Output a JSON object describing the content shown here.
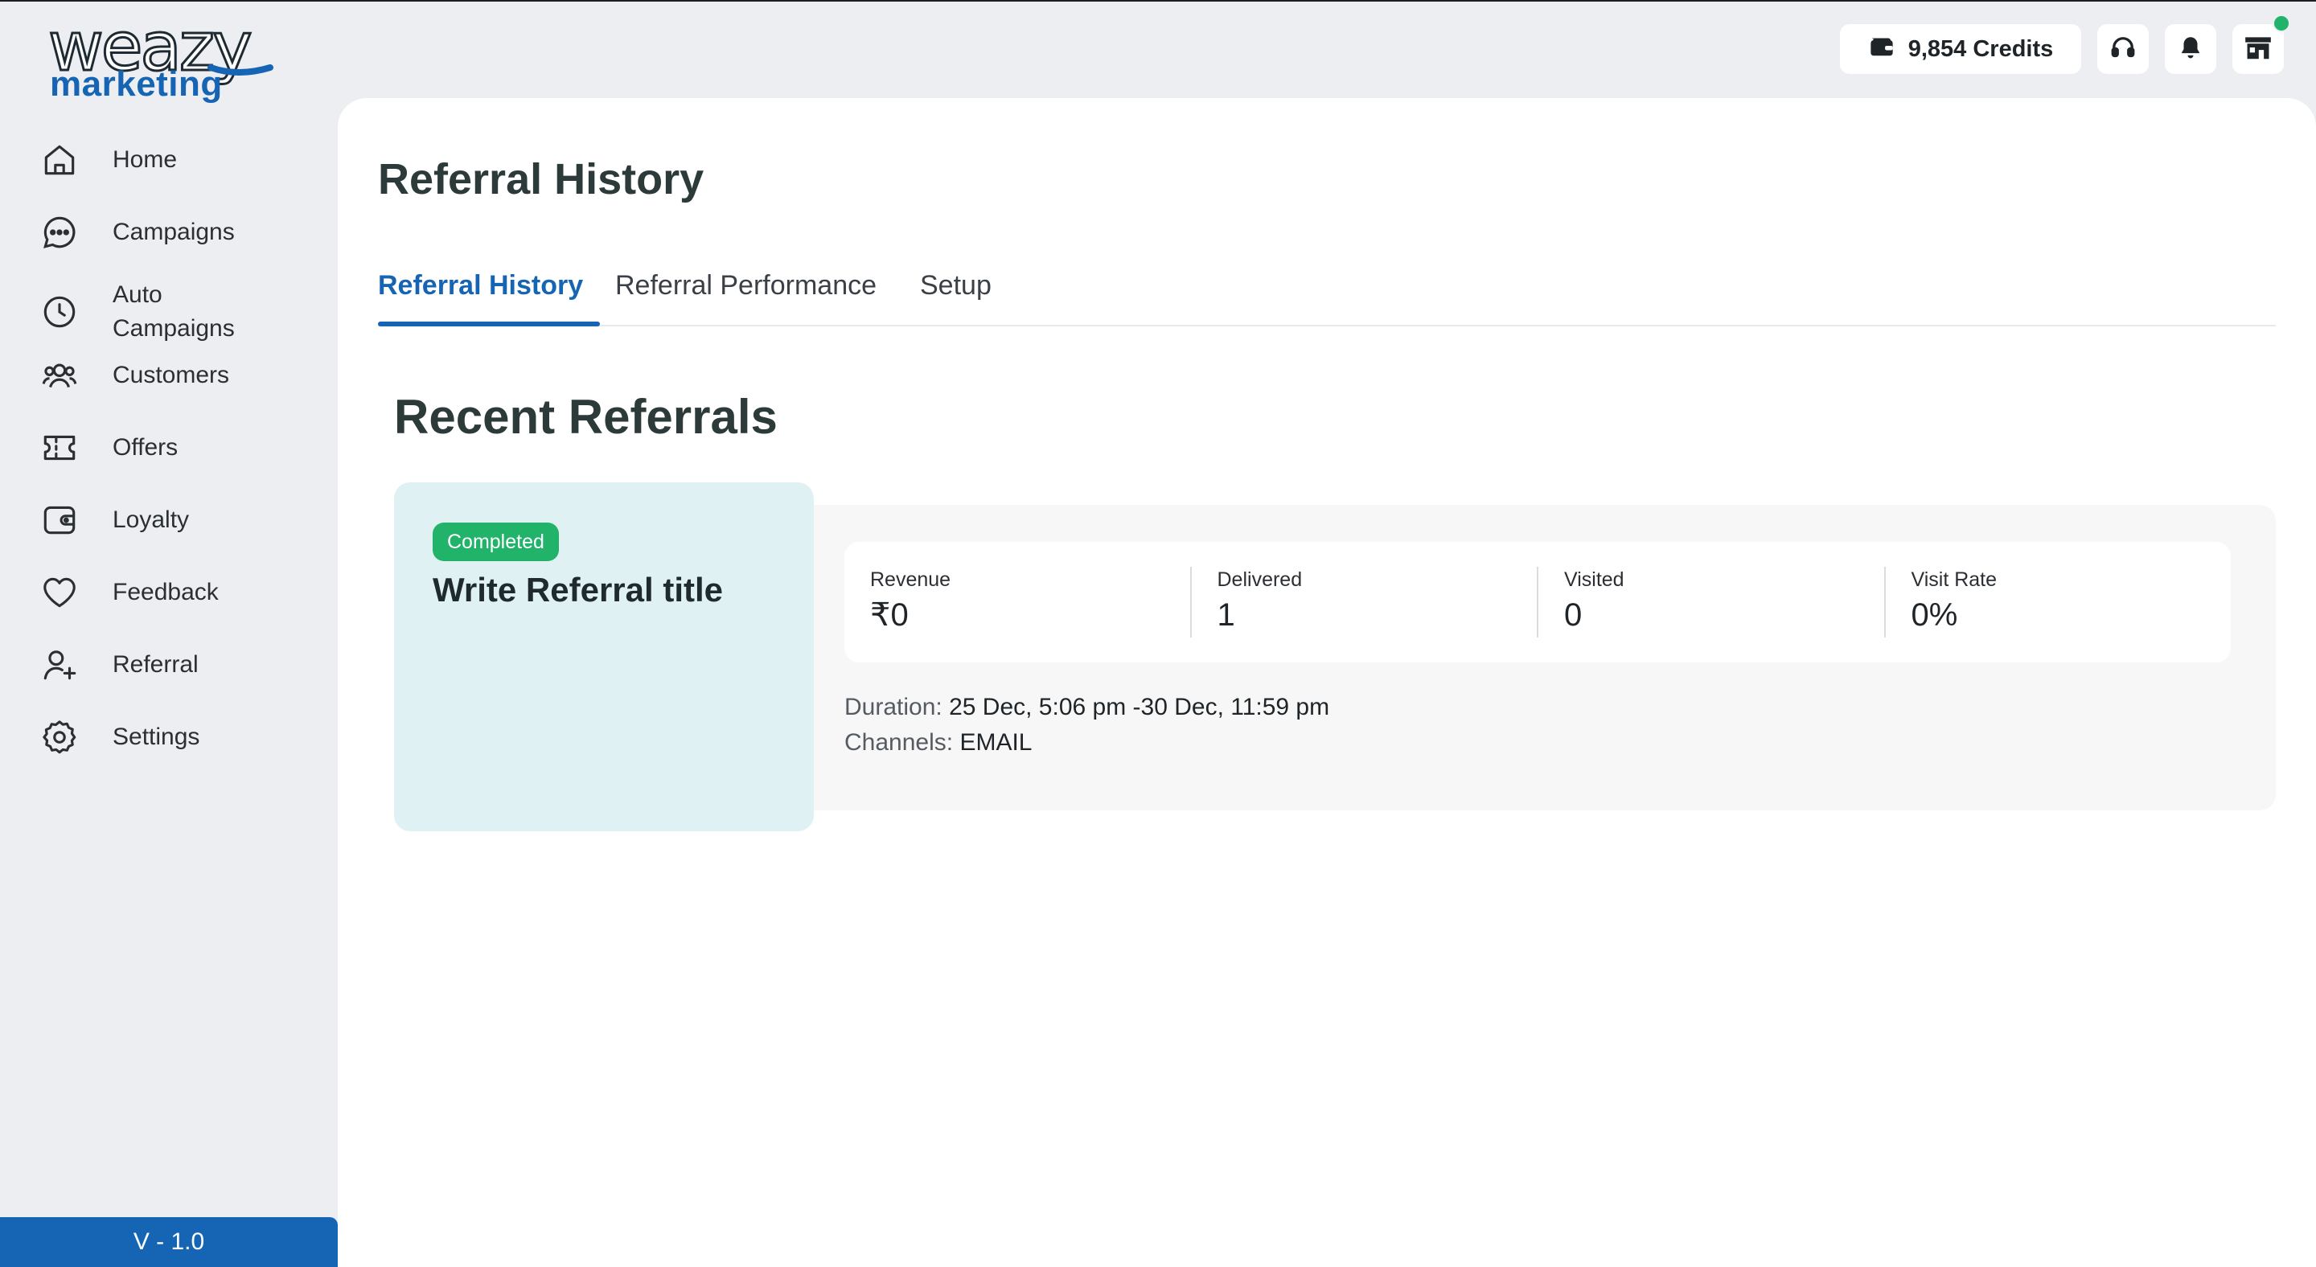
{
  "app": {
    "logo_text": "weazy",
    "logo_subtext": "marketing",
    "version": "V - 1.0"
  },
  "sidebar": {
    "items": [
      {
        "label": "Home",
        "icon": "home-icon"
      },
      {
        "label": "Campaigns",
        "icon": "chat-bubble-icon"
      },
      {
        "label": "Auto Campaigns",
        "icon": "clock-icon"
      },
      {
        "label": "Customers",
        "icon": "users-icon"
      },
      {
        "label": "Offers",
        "icon": "ticket-icon"
      },
      {
        "label": "Loyalty",
        "icon": "wallet-icon"
      },
      {
        "label": "Feedback",
        "icon": "heart-icon"
      },
      {
        "label": "Referral",
        "icon": "user-plus-icon"
      },
      {
        "label": "Settings",
        "icon": "gear-icon"
      }
    ]
  },
  "header": {
    "credits_label": "9,854 Credits",
    "icons": [
      "wallet-icon",
      "headset-icon",
      "bell-icon",
      "store-icon"
    ],
    "status_color": "#21b36a"
  },
  "main": {
    "page_title": "Referral History",
    "tabs": [
      {
        "label": "Referral History",
        "active": true
      },
      {
        "label": "Referral Performance",
        "active": false
      },
      {
        "label": "Setup",
        "active": false
      }
    ],
    "section_title": "Recent Referrals",
    "referrals": [
      {
        "status": "Completed",
        "title": "Write Referral title",
        "stats": [
          {
            "label": "Revenue",
            "value": "₹0"
          },
          {
            "label": "Delivered",
            "value": "1"
          },
          {
            "label": "Visited",
            "value": "0"
          },
          {
            "label": "Visit Rate",
            "value": "0%"
          }
        ],
        "duration_label": "Duration:",
        "duration_value": "25 Dec, 5:06 pm -30 Dec, 11:59 pm",
        "channels_label": "Channels:",
        "channels_value": "EMAIL"
      }
    ]
  },
  "colors": {
    "accent": "#1565b4",
    "success": "#21b36a",
    "card_bg": "#e0f1f4"
  }
}
